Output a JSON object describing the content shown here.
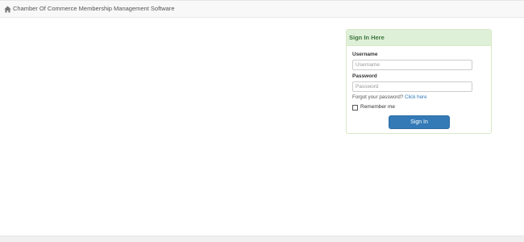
{
  "navbar": {
    "brand_icon": "home-icon",
    "brand_text": "Chamber Of Commerce Membership Management Software"
  },
  "login_panel": {
    "heading": "Sign In Here",
    "username": {
      "label": "Username",
      "value": "",
      "placeholder": "Username"
    },
    "password": {
      "label": "Password",
      "value": "",
      "placeholder": "Password"
    },
    "forgot_text": "Forgot your password?",
    "forgot_link": "Click here",
    "remember_label": "Remember me",
    "remember_checked": false,
    "submit_label": "Sign In"
  },
  "colors": {
    "panel_heading_bg": "#dff0d8",
    "panel_heading_text": "#3c763d",
    "primary_button": "#337ab7",
    "link": "#337ab7"
  }
}
